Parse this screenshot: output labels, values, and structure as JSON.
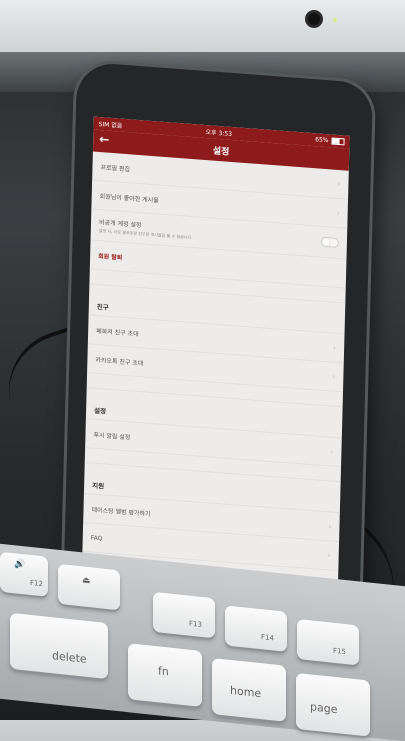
{
  "status_bar": {
    "carrier": "SIM 없음",
    "time": "오후 3:53",
    "battery": "65%"
  },
  "nav": {
    "title": "설정",
    "back_icon": "arrow-left-icon"
  },
  "menu": {
    "profile_edit": "프로필 편집",
    "liked_posts": "회원님이 좋아한 게시물",
    "private_account": "비공개 계정 설정",
    "private_account_desc": "설정 시, 사로 팔로우한 친구만 게시물을 볼 수 있습니다",
    "withdraw": "회원 탈퇴"
  },
  "friends": {
    "header": "친구",
    "invite_facebook": "페북져 친구 초대",
    "invite_kakao": "카카오톡 친구 초대"
  },
  "settings": {
    "header": "설정",
    "push": "푸시 알림 설정"
  },
  "support": {
    "header": "지원",
    "rate": "테이스팅 앨범 평가하기",
    "faq": "FAQ"
  },
  "keyboard": {
    "f12": "F12",
    "f13": "F13",
    "f14": "F14",
    "f15": "F15",
    "delete": "delete",
    "fn": "fn",
    "home": "home",
    "page": "page"
  }
}
